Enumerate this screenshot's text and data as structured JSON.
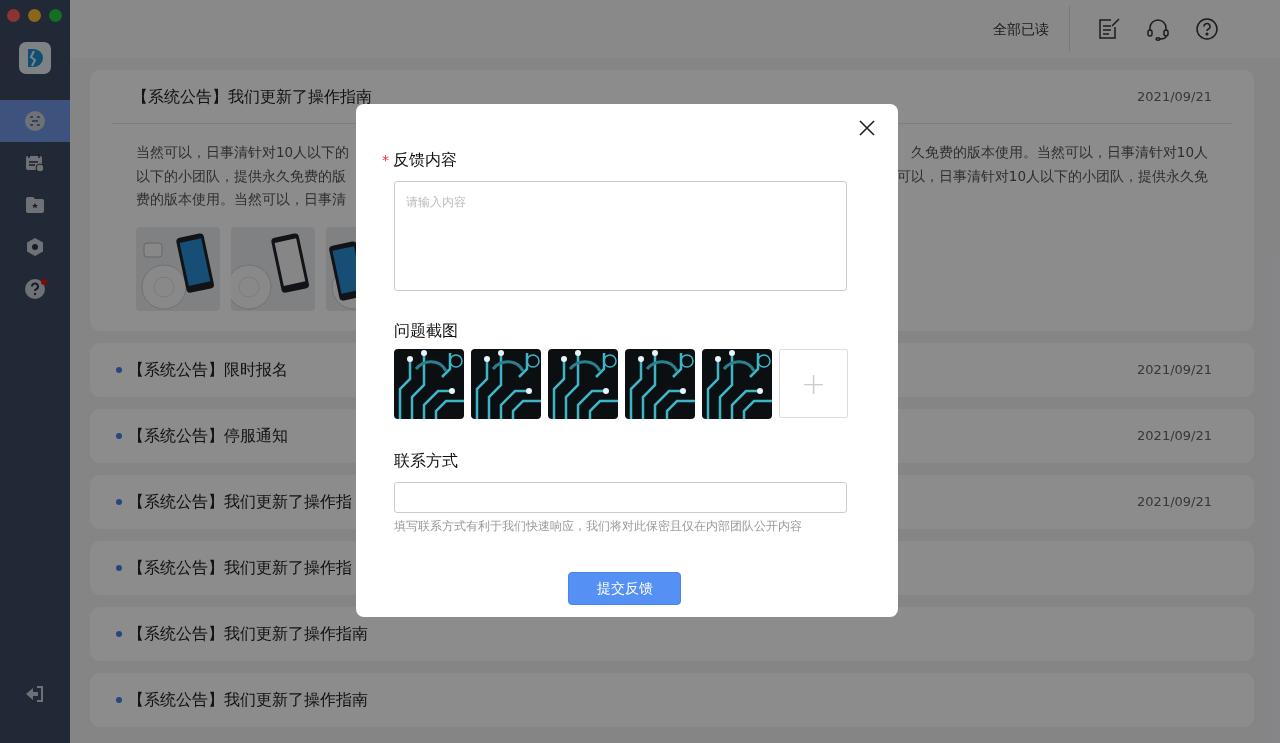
{
  "sidebar": {
    "items": [
      {
        "selected": true
      },
      {
        "selected": false
      },
      {
        "selected": false
      },
      {
        "selected": false
      },
      {
        "selected": false,
        "badge": true
      }
    ]
  },
  "header": {
    "mark_all_read": "全部已读"
  },
  "announcements": [
    {
      "title": "【系统公告】我们更新了操作指南",
      "date": "2021/09/21",
      "unread": false,
      "expanded": true,
      "body_lines": [
        {
          "left": "当然可以，日事清针对10人以下的",
          "right": "久免费的版本使用。当然可以，日事清针对10人"
        },
        {
          "left": "以下的小团队，提供永久免费的版",
          "right": "可以，日事清针对10人以下的小团队，提供永久免"
        },
        {
          "left": "费的版本使用。当然可以，日事清"
        }
      ]
    },
    {
      "title": "【系统公告】限时报名",
      "date": "2021/09/21",
      "unread": true,
      "expanded": false
    },
    {
      "title": "【系统公告】停服通知",
      "date": "2021/09/21",
      "unread": true,
      "expanded": false
    },
    {
      "title": "【系统公告】我们更新了操作指",
      "date": "2021/09/21",
      "unread": true,
      "expanded": false
    },
    {
      "title": "【系统公告】我们更新了操作指",
      "unread": true,
      "expanded": false
    },
    {
      "title": "【系统公告】我们更新了操作指南",
      "unread": true,
      "expanded": false
    },
    {
      "title": "【系统公告】我们更新了操作指南",
      "unread": true,
      "expanded": false
    }
  ],
  "dialog": {
    "feedback_label": "反馈内容",
    "required_mark": "*",
    "feedback_placeholder": "请输入内容",
    "screenshots_label": "问题截图",
    "add_symbol": "+",
    "contact_label": "联系方式",
    "contact_hint": "填写联系方式有利于我们快速响应，我们将对此保密且仅在内部团队公开内容",
    "submit": "提交反馈"
  }
}
